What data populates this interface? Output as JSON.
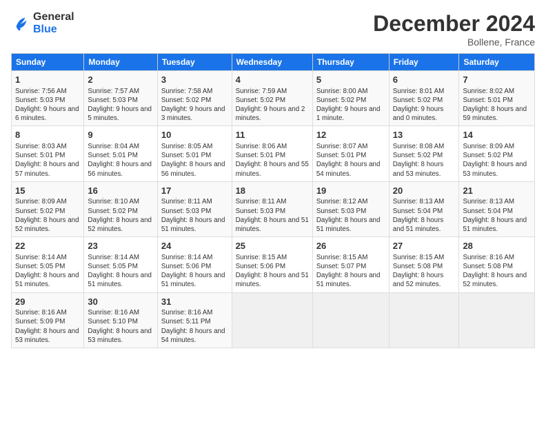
{
  "logo": {
    "line1": "General",
    "line2": "Blue"
  },
  "title": "December 2024",
  "location": "Bollene, France",
  "days_of_week": [
    "Sunday",
    "Monday",
    "Tuesday",
    "Wednesday",
    "Thursday",
    "Friday",
    "Saturday"
  ],
  "weeks": [
    [
      {
        "day": 1,
        "sunrise": "7:56 AM",
        "sunset": "5:03 PM",
        "daylight": "9 hours and 6 minutes."
      },
      {
        "day": 2,
        "sunrise": "7:57 AM",
        "sunset": "5:03 PM",
        "daylight": "9 hours and 5 minutes."
      },
      {
        "day": 3,
        "sunrise": "7:58 AM",
        "sunset": "5:02 PM",
        "daylight": "9 hours and 3 minutes."
      },
      {
        "day": 4,
        "sunrise": "7:59 AM",
        "sunset": "5:02 PM",
        "daylight": "9 hours and 2 minutes."
      },
      {
        "day": 5,
        "sunrise": "8:00 AM",
        "sunset": "5:02 PM",
        "daylight": "9 hours and 1 minute."
      },
      {
        "day": 6,
        "sunrise": "8:01 AM",
        "sunset": "5:02 PM",
        "daylight": "9 hours and 0 minutes."
      },
      {
        "day": 7,
        "sunrise": "8:02 AM",
        "sunset": "5:01 PM",
        "daylight": "8 hours and 59 minutes."
      }
    ],
    [
      {
        "day": 8,
        "sunrise": "8:03 AM",
        "sunset": "5:01 PM",
        "daylight": "8 hours and 57 minutes."
      },
      {
        "day": 9,
        "sunrise": "8:04 AM",
        "sunset": "5:01 PM",
        "daylight": "8 hours and 56 minutes."
      },
      {
        "day": 10,
        "sunrise": "8:05 AM",
        "sunset": "5:01 PM",
        "daylight": "8 hours and 56 minutes."
      },
      {
        "day": 11,
        "sunrise": "8:06 AM",
        "sunset": "5:01 PM",
        "daylight": "8 hours and 55 minutes."
      },
      {
        "day": 12,
        "sunrise": "8:07 AM",
        "sunset": "5:01 PM",
        "daylight": "8 hours and 54 minutes."
      },
      {
        "day": 13,
        "sunrise": "8:08 AM",
        "sunset": "5:02 PM",
        "daylight": "8 hours and 53 minutes."
      },
      {
        "day": 14,
        "sunrise": "8:09 AM",
        "sunset": "5:02 PM",
        "daylight": "8 hours and 53 minutes."
      }
    ],
    [
      {
        "day": 15,
        "sunrise": "8:09 AM",
        "sunset": "5:02 PM",
        "daylight": "8 hours and 52 minutes."
      },
      {
        "day": 16,
        "sunrise": "8:10 AM",
        "sunset": "5:02 PM",
        "daylight": "8 hours and 52 minutes."
      },
      {
        "day": 17,
        "sunrise": "8:11 AM",
        "sunset": "5:03 PM",
        "daylight": "8 hours and 51 minutes."
      },
      {
        "day": 18,
        "sunrise": "8:11 AM",
        "sunset": "5:03 PM",
        "daylight": "8 hours and 51 minutes."
      },
      {
        "day": 19,
        "sunrise": "8:12 AM",
        "sunset": "5:03 PM",
        "daylight": "8 hours and 51 minutes."
      },
      {
        "day": 20,
        "sunrise": "8:13 AM",
        "sunset": "5:04 PM",
        "daylight": "8 hours and 51 minutes."
      },
      {
        "day": 21,
        "sunrise": "8:13 AM",
        "sunset": "5:04 PM",
        "daylight": "8 hours and 51 minutes."
      }
    ],
    [
      {
        "day": 22,
        "sunrise": "8:14 AM",
        "sunset": "5:05 PM",
        "daylight": "8 hours and 51 minutes."
      },
      {
        "day": 23,
        "sunrise": "8:14 AM",
        "sunset": "5:05 PM",
        "daylight": "8 hours and 51 minutes."
      },
      {
        "day": 24,
        "sunrise": "8:14 AM",
        "sunset": "5:06 PM",
        "daylight": "8 hours and 51 minutes."
      },
      {
        "day": 25,
        "sunrise": "8:15 AM",
        "sunset": "5:06 PM",
        "daylight": "8 hours and 51 minutes."
      },
      {
        "day": 26,
        "sunrise": "8:15 AM",
        "sunset": "5:07 PM",
        "daylight": "8 hours and 51 minutes."
      },
      {
        "day": 27,
        "sunrise": "8:15 AM",
        "sunset": "5:08 PM",
        "daylight": "8 hours and 52 minutes."
      },
      {
        "day": 28,
        "sunrise": "8:16 AM",
        "sunset": "5:08 PM",
        "daylight": "8 hours and 52 minutes."
      }
    ],
    [
      {
        "day": 29,
        "sunrise": "8:16 AM",
        "sunset": "5:09 PM",
        "daylight": "8 hours and 53 minutes."
      },
      {
        "day": 30,
        "sunrise": "8:16 AM",
        "sunset": "5:10 PM",
        "daylight": "8 hours and 53 minutes."
      },
      {
        "day": 31,
        "sunrise": "8:16 AM",
        "sunset": "5:11 PM",
        "daylight": "8 hours and 54 minutes."
      },
      null,
      null,
      null,
      null
    ]
  ]
}
